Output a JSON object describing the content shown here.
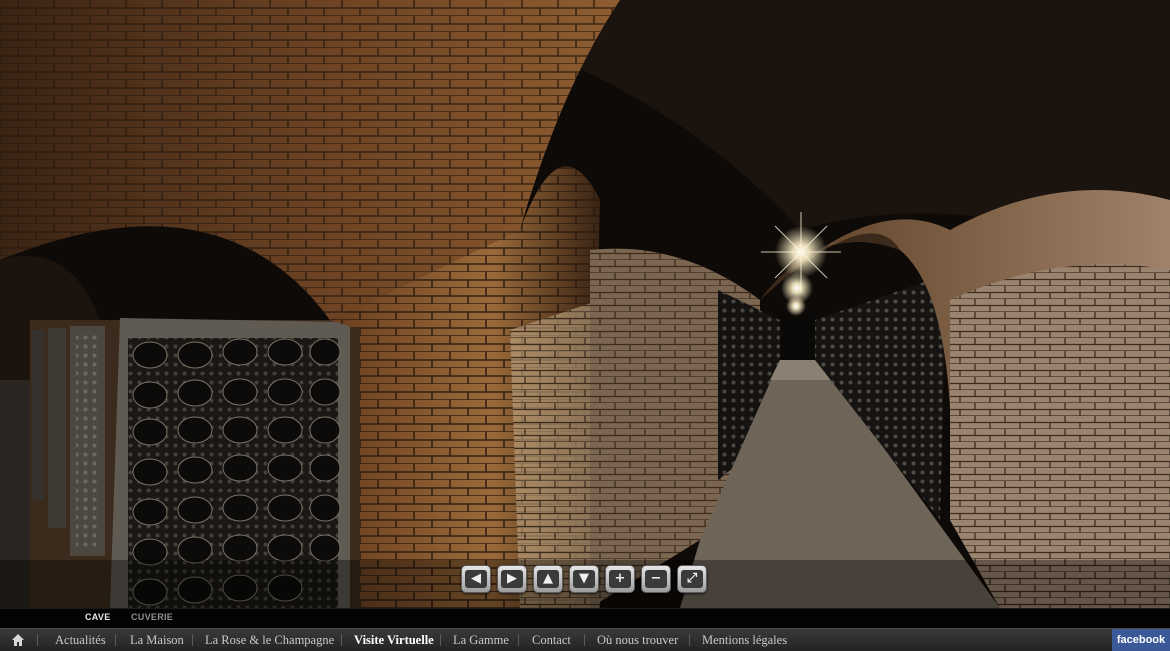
{
  "panorama": {
    "controls": [
      {
        "name": "pan-left-button",
        "icon": "arrow-left-icon",
        "glyph": "◀"
      },
      {
        "name": "pan-right-button",
        "icon": "arrow-right-icon",
        "glyph": "▶"
      },
      {
        "name": "pan-up-button",
        "icon": "arrow-up-icon",
        "glyph": "▲"
      },
      {
        "name": "pan-down-button",
        "icon": "arrow-down-icon",
        "glyph": "▼"
      },
      {
        "name": "zoom-in-button",
        "icon": "plus-icon",
        "glyph": "+"
      },
      {
        "name": "zoom-out-button",
        "icon": "minus-icon",
        "glyph": "−"
      },
      {
        "name": "fullscreen-button",
        "icon": "fullscreen-icon",
        "glyph": "⤢"
      }
    ]
  },
  "scenes": {
    "items": [
      {
        "label": "CAVE",
        "active": true
      },
      {
        "label": "CUVERIE",
        "active": false
      }
    ]
  },
  "menu": {
    "home_icon": "home-icon",
    "items": [
      {
        "label": "Actualités",
        "current": false
      },
      {
        "label": "La Maison",
        "current": false
      },
      {
        "label": "La Rose & le Champagne",
        "current": false
      },
      {
        "label": "Visite Virtuelle",
        "current": true
      },
      {
        "label": "La Gamme",
        "current": false
      },
      {
        "label": "Contact",
        "current": false
      },
      {
        "label": "Où nous trouver",
        "current": false
      },
      {
        "label": "Mentions légales",
        "current": false
      }
    ],
    "facebook_label": "facebook"
  },
  "colors": {
    "facebook": "#3b5998",
    "menu_bg": "#2c2c2c",
    "brick": "#8a5a2e"
  }
}
